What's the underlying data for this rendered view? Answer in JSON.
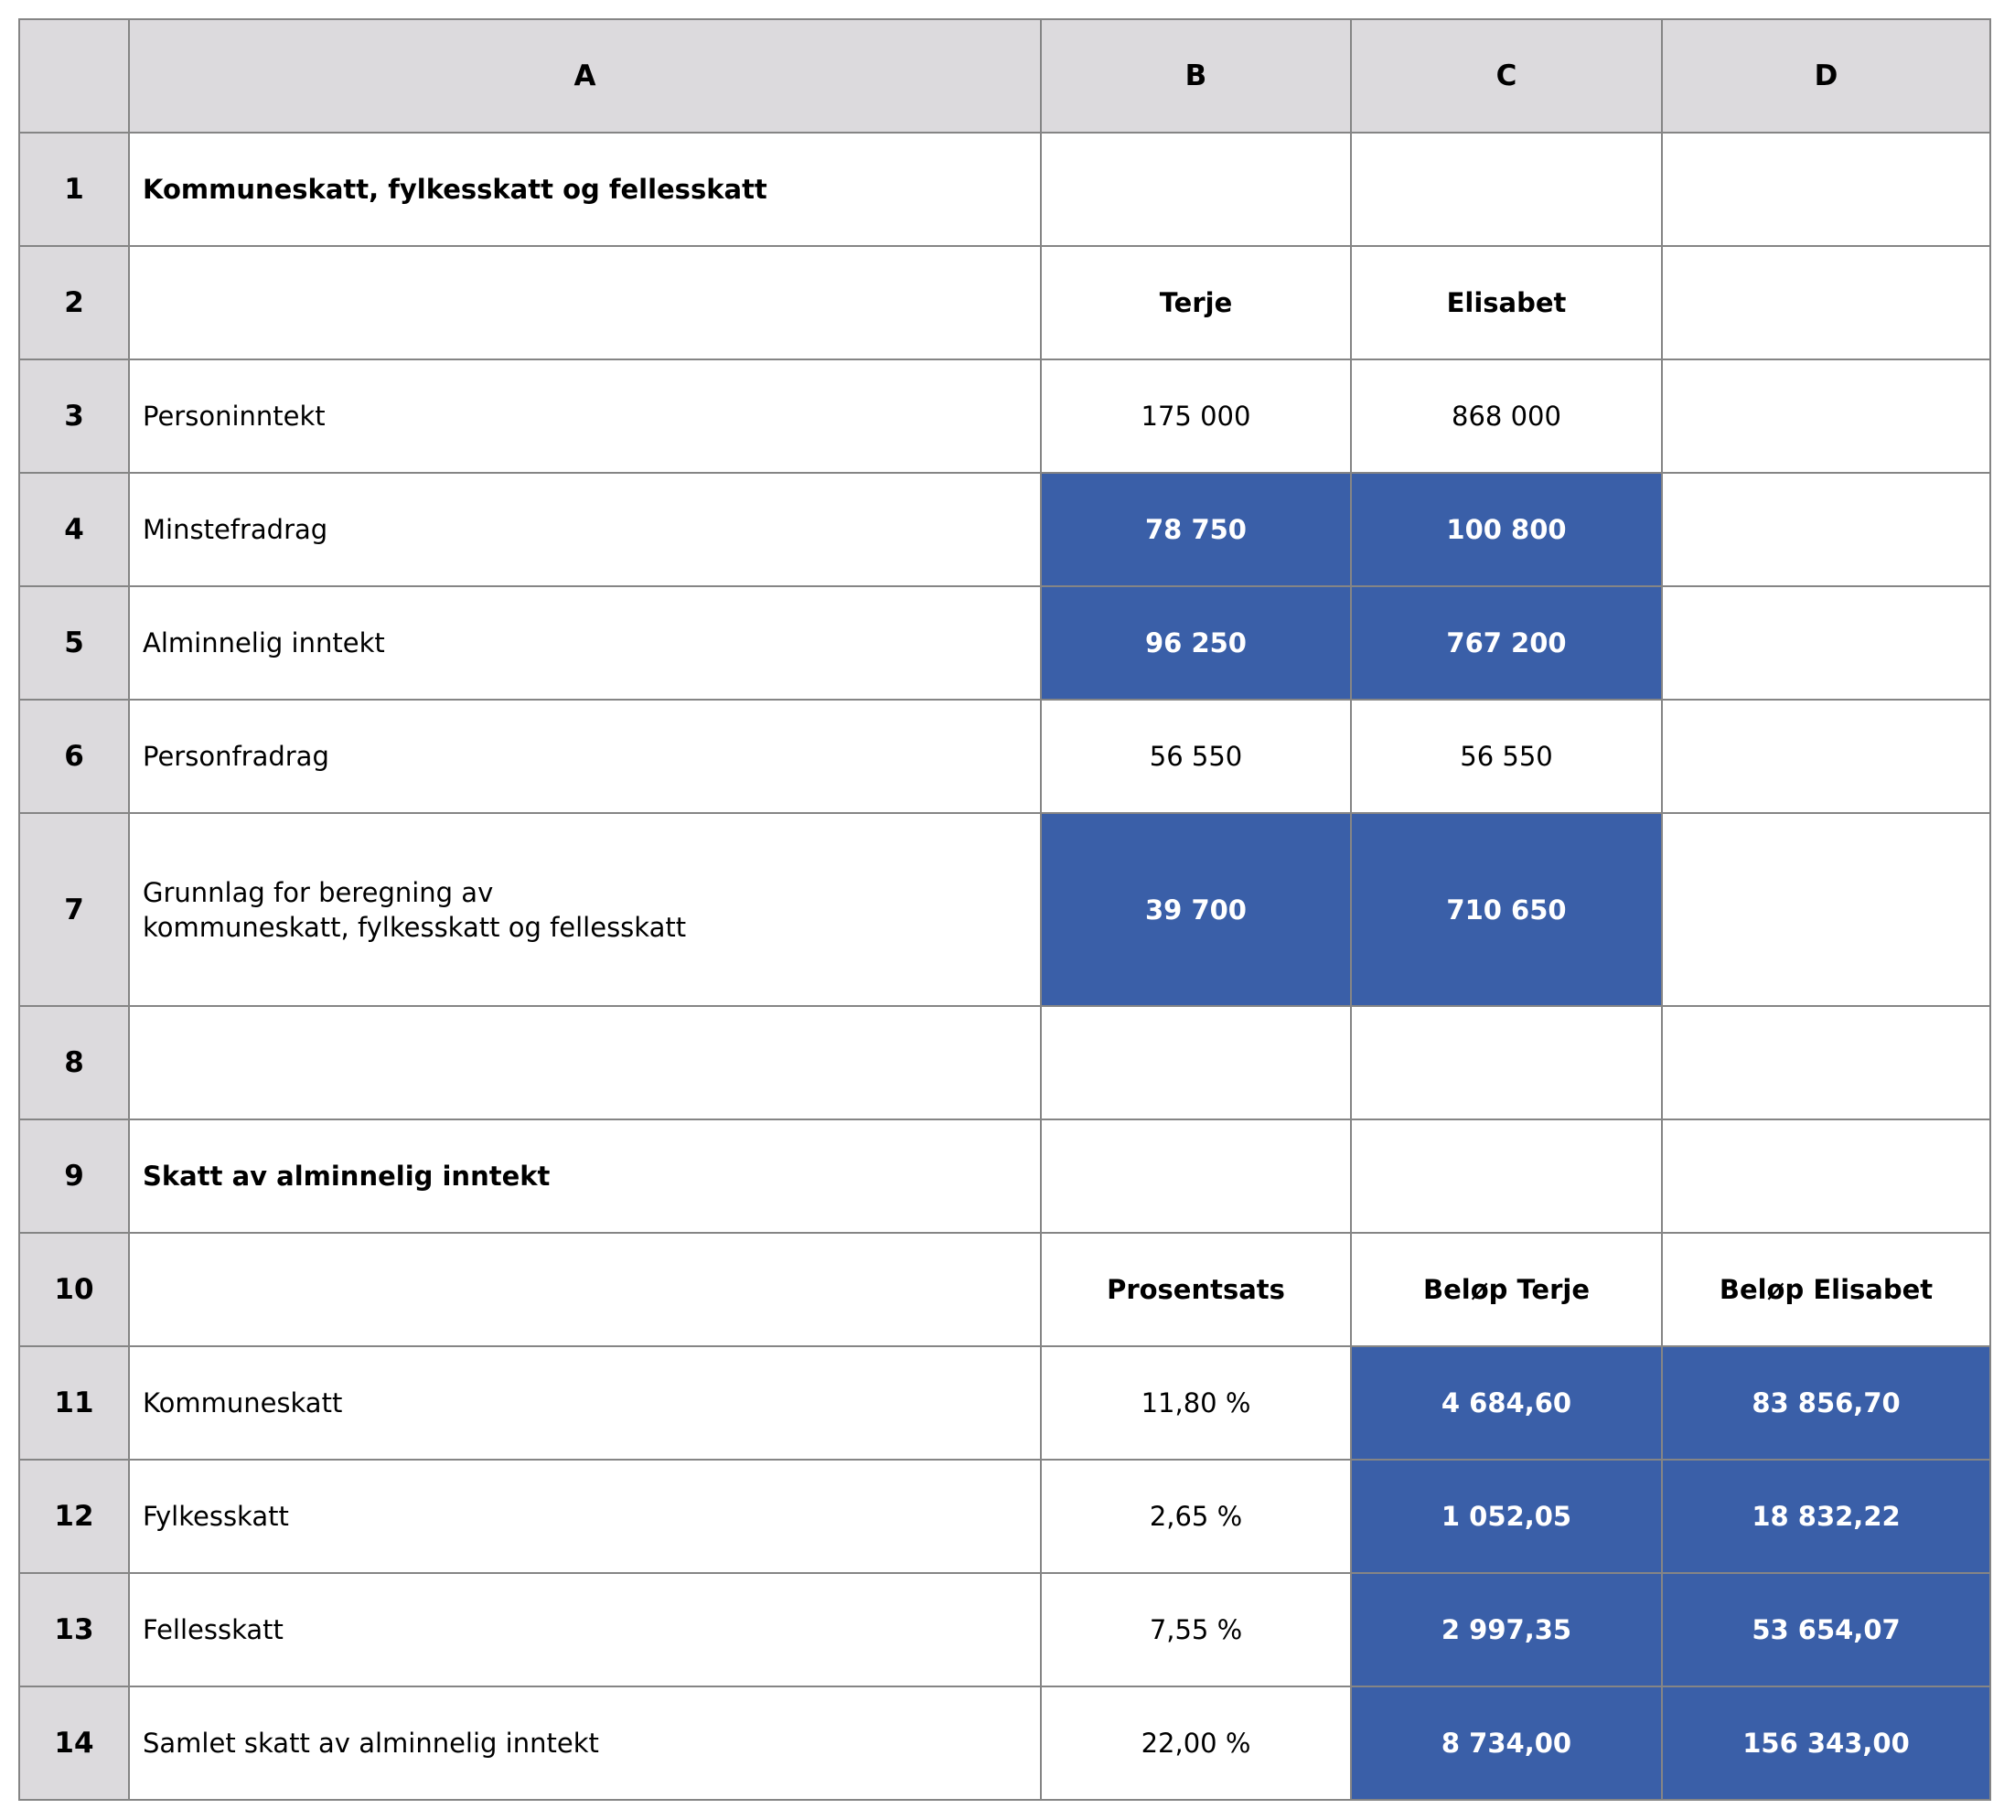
{
  "columns": [
    "A",
    "B",
    "C",
    "D"
  ],
  "rows": [
    {
      "num": "1",
      "a": "Kommuneskatt, fylkesskatt og fellesskatt",
      "b": "",
      "c": "",
      "d": ""
    },
    {
      "num": "2",
      "a": "",
      "b": "Terje",
      "c": "Elisabet",
      "d": ""
    },
    {
      "num": "3",
      "a": "Personinntekt",
      "b": "175 000",
      "c": "868 000",
      "d": ""
    },
    {
      "num": "4",
      "a": "Minstefradrag",
      "b": "78 750",
      "c": "100 800",
      "d": ""
    },
    {
      "num": "5",
      "a": "Alminnelig inntekt",
      "b": "96 250",
      "c": "767 200",
      "d": ""
    },
    {
      "num": "6",
      "a": "Personfradrag",
      "b": "56 550",
      "c": "56 550",
      "d": ""
    },
    {
      "num": "7",
      "a": [
        "Grunnlag for beregning av",
        "kommuneskatt, fylkesskatt og fellesskatt"
      ],
      "b": "39 700",
      "c": "710 650",
      "d": ""
    },
    {
      "num": "8",
      "a": "",
      "b": "",
      "c": "",
      "d": ""
    },
    {
      "num": "9",
      "a": "Skatt av alminnelig inntekt",
      "b": "",
      "c": "",
      "d": ""
    },
    {
      "num": "10",
      "a": "",
      "b": "Prosentsats",
      "c": "Beløp Terje",
      "d": "Beløp Elisabet"
    },
    {
      "num": "11",
      "a": "Kommuneskatt",
      "b": "11,80 %",
      "c": "4 684,60",
      "d": "83 856,70"
    },
    {
      "num": "12",
      "a": "Fylkesskatt",
      "b": "2,65 %",
      "c": "1 052,05",
      "d": "18 832,22"
    },
    {
      "num": "13",
      "a": "Fellesskatt",
      "b": "7,55 %",
      "c": "2 997,35",
      "d": "53 654,07"
    },
    {
      "num": "14",
      "a": "Samlet skatt av alminnelig inntekt",
      "b": "22,00 %",
      "c": "8 734,00",
      "d": "156 343,00"
    }
  ],
  "colors": {
    "header_bg": "#dcdadd",
    "highlight_bg": "#3a5fa8",
    "grid": "#858585"
  }
}
